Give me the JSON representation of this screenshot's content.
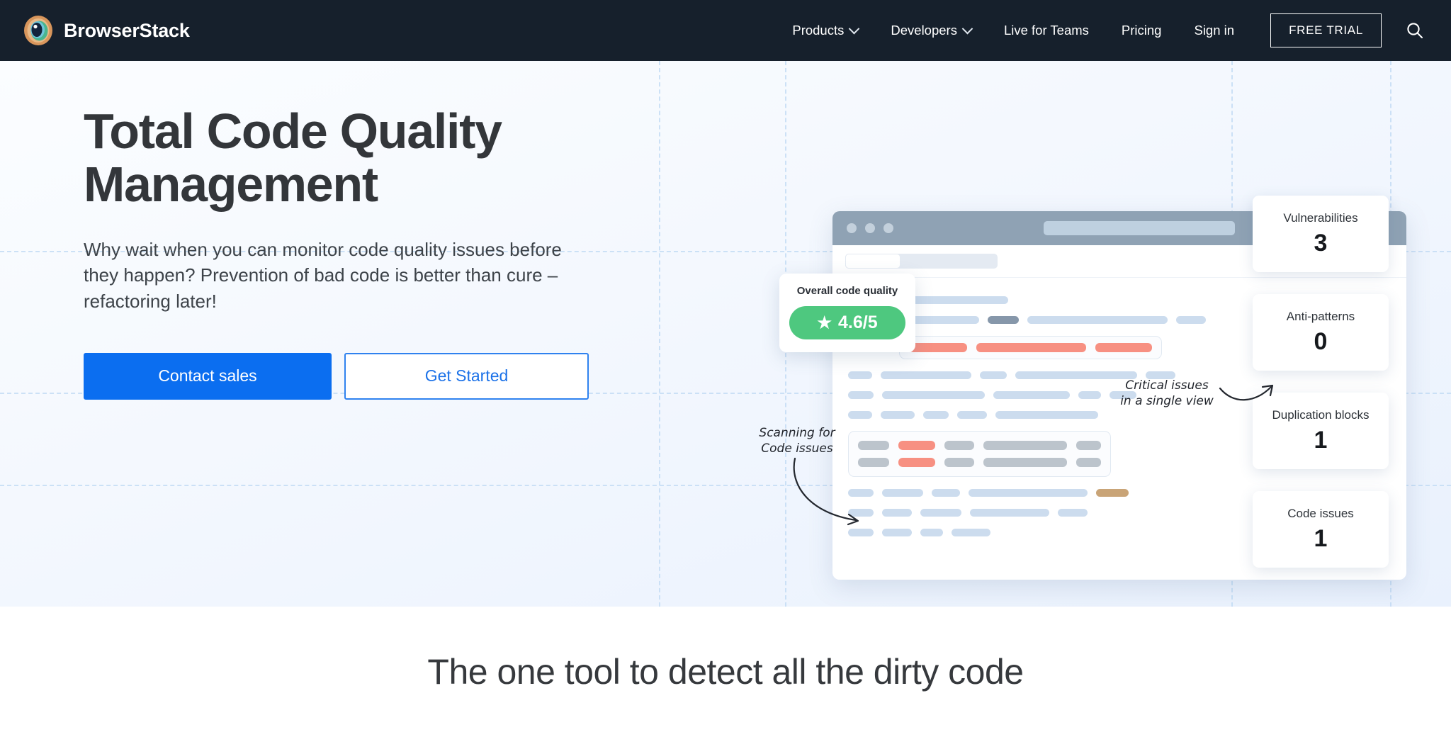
{
  "nav": {
    "brand": "BrowserStack",
    "logo_icon": "browserstack-eye-icon",
    "items": [
      {
        "label": "Products",
        "has_dropdown": true,
        "icon": "chevron-down-icon"
      },
      {
        "label": "Developers",
        "has_dropdown": true,
        "icon": "chevron-down-icon"
      },
      {
        "label": "Live for Teams",
        "has_dropdown": false
      },
      {
        "label": "Pricing",
        "has_dropdown": false
      },
      {
        "label": "Sign in",
        "has_dropdown": false
      }
    ],
    "free_trial_label": "FREE TRIAL",
    "search_icon": "search-icon",
    "background_color": "#16202c"
  },
  "hero": {
    "title": "Total Code Quality Management",
    "subtitle": "Why wait when you can monitor code quality issues before they happen? Prevention of bad code is better than cure – refactoring later!",
    "primary_cta": "Contact sales",
    "secondary_cta": "Get Started",
    "primary_color": "#0b6ef0",
    "secondary_color": "#2f82ef"
  },
  "illustration": {
    "rating": {
      "label": "Overall code quality",
      "score": "4.6/5",
      "star_icon": "star-icon",
      "pill_color": "#4ec87f"
    },
    "metrics": [
      {
        "label": "Vulnerabilities",
        "value": "3"
      },
      {
        "label": "Anti-patterns",
        "value": "0"
      },
      {
        "label": "Duplication blocks",
        "value": "1"
      },
      {
        "label": "Code issues",
        "value": "1"
      }
    ],
    "annotations": [
      {
        "text": "Scanning for\nCode issues",
        "arrow": "curved-arrow-down-right-icon"
      },
      {
        "text": "Critical issues\nin a single view",
        "arrow": "curved-arrow-right-icon"
      }
    ],
    "window_dots": 3
  },
  "bottom_section": {
    "title": "The one tool to detect all the dirty code"
  }
}
